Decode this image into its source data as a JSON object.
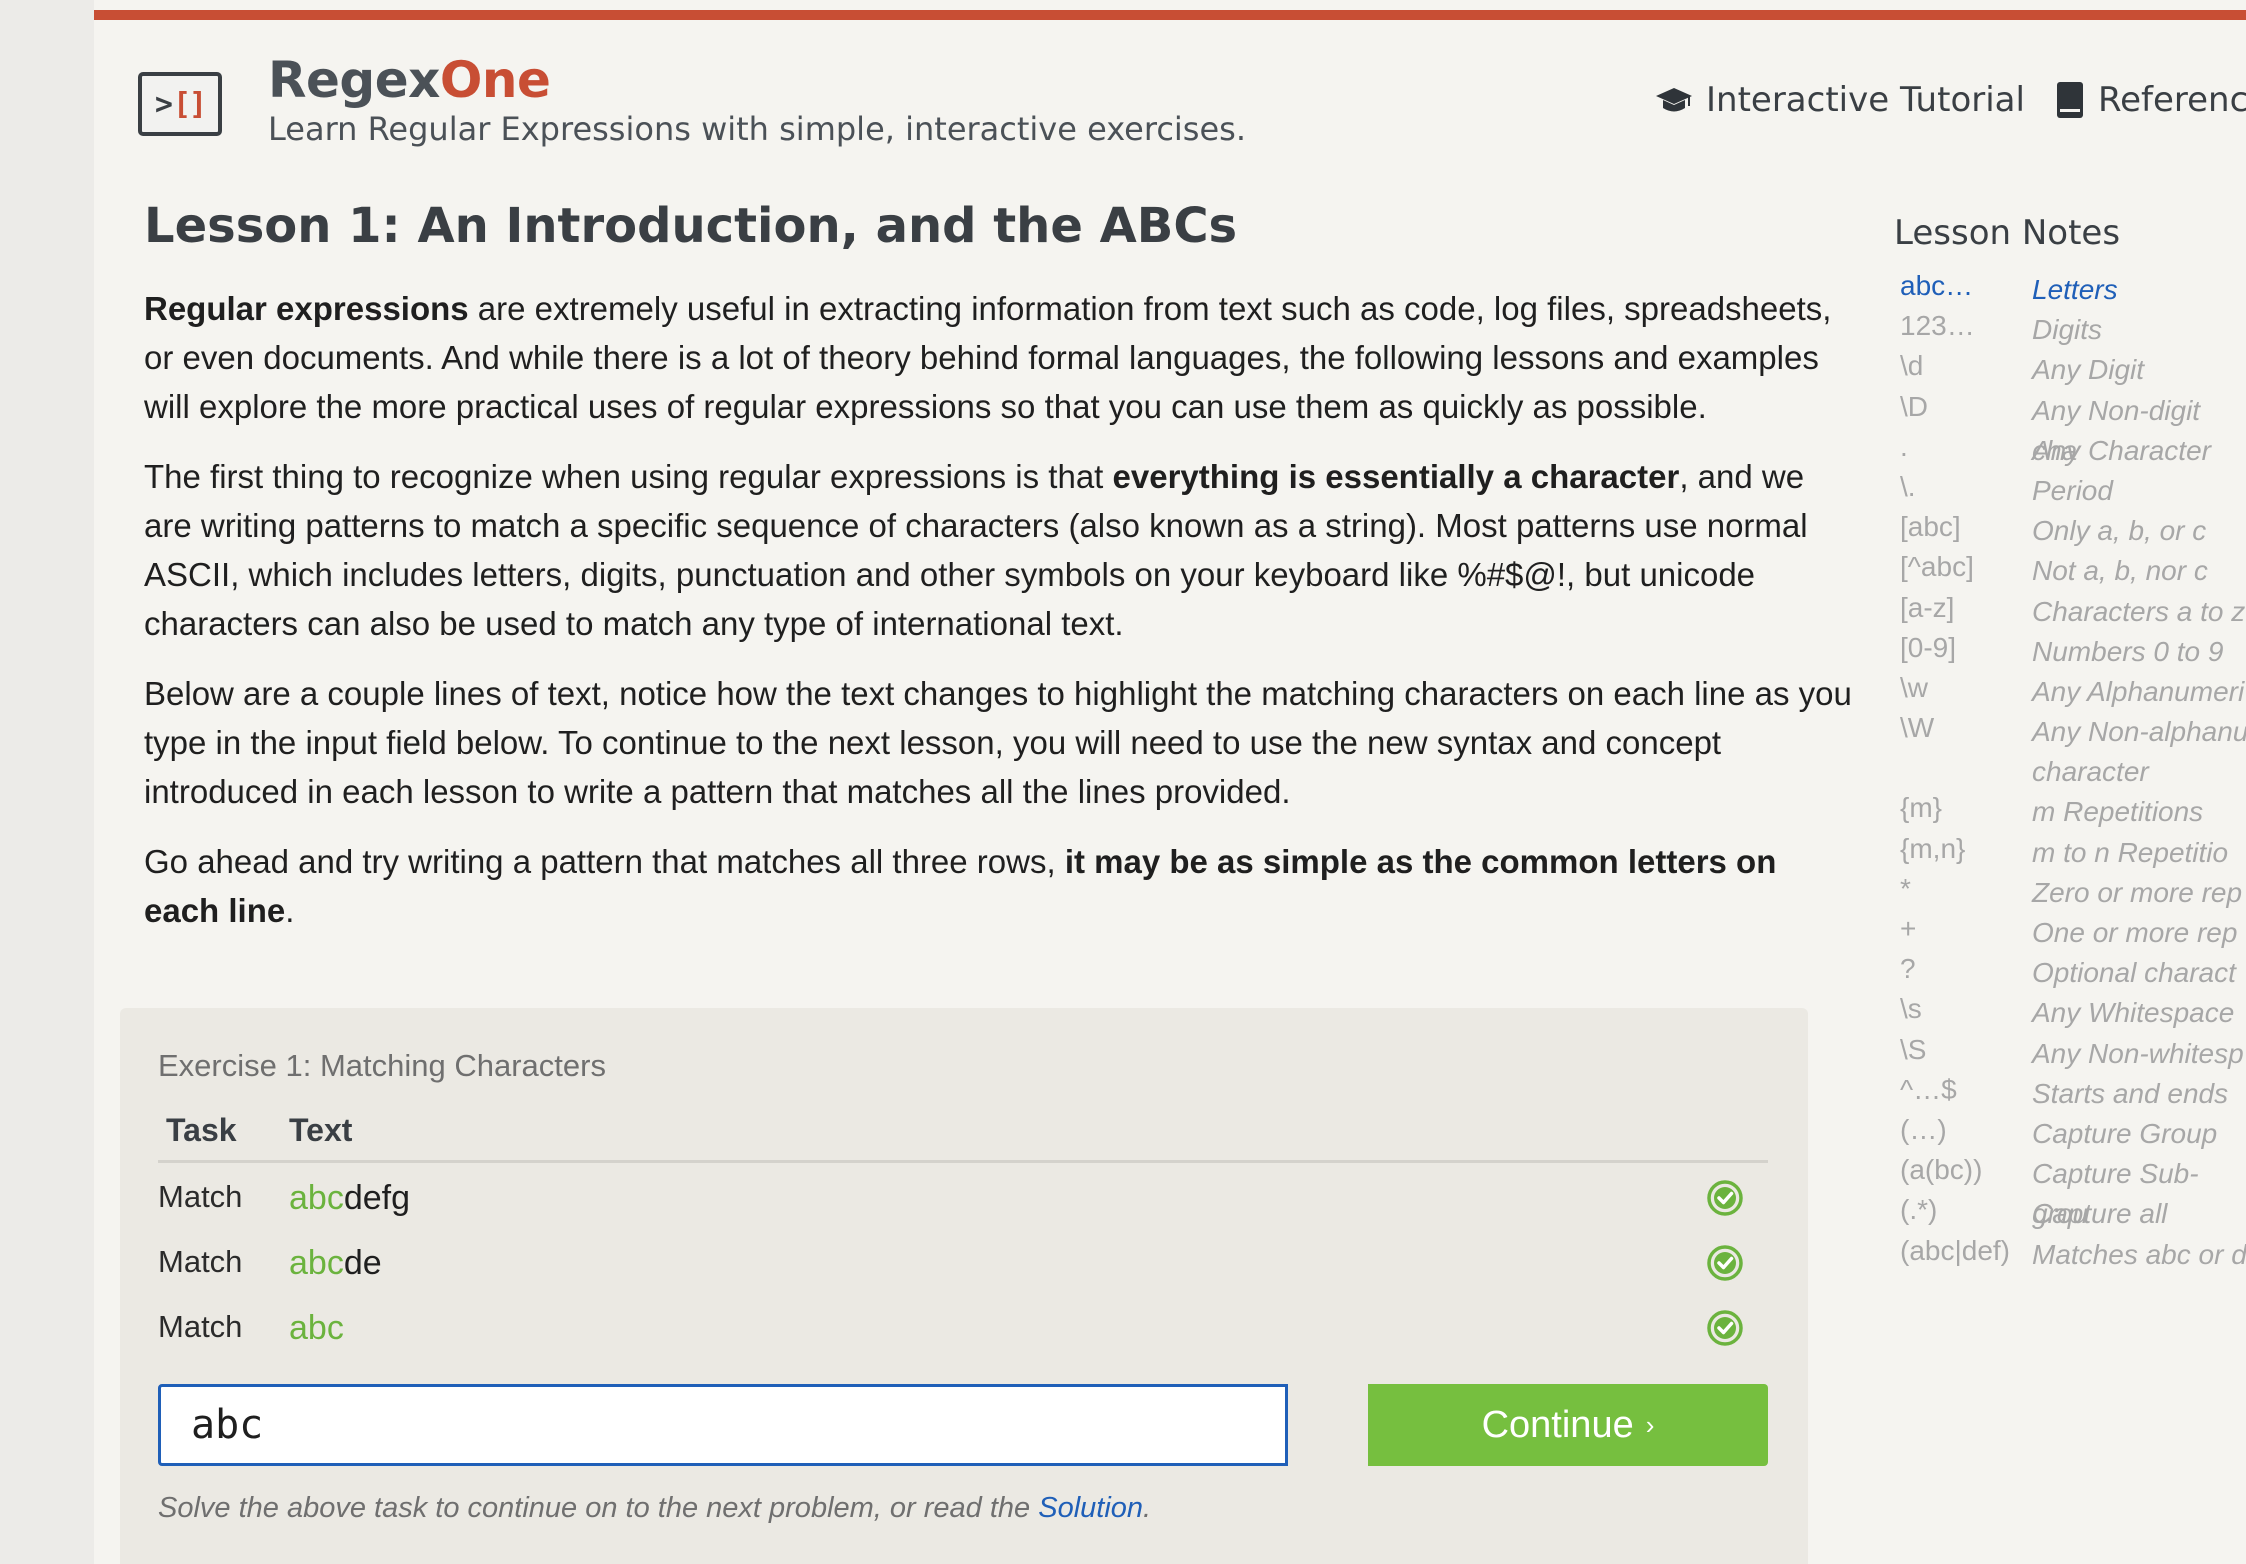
{
  "header": {
    "brand_part1": "Regex",
    "brand_part2": "One",
    "tagline": "Learn Regular Expressions with simple, interactive exercises.",
    "nav": [
      {
        "label": "Interactive Tutorial",
        "icon": "graduation-cap-icon"
      },
      {
        "label": "Referenc",
        "icon": "book-icon"
      }
    ]
  },
  "lesson": {
    "title": "Lesson 1: An Introduction, and the ABCs",
    "p1_bold": "Regular expressions",
    "p1_rest": " are extremely useful in extracting information from text such as code, log files, spreadsheets, or even documents. And while there is a lot of theory behind formal languages, the following lessons and examples will explore the more practical uses of regular expressions so that you can use them as quickly as possible.",
    "p2_start": "The first thing to recognize when using regular expressions is that ",
    "p2_bold": "everything is essentially a character",
    "p2_rest": ", and we are writing patterns to match a specific sequence of characters (also known as a string). Most patterns use normal ASCII, which includes letters, digits, punctuation and other symbols on your keyboard like %#$@!, but unicode characters can also be used to match any type of international text.",
    "p3": "Below are a couple lines of text, notice how the text changes to highlight the matching characters on each line as you type in the input field below. To continue to the next lesson, you will need to use the new syntax and concept introduced in each lesson to write a pattern that matches all the lines provided.",
    "p4_start": "Go ahead and try writing a pattern that matches all three rows, ",
    "p4_bold": "it may be as simple as the common letters on each line",
    "p4_end": "."
  },
  "exercise": {
    "title": "Exercise 1: Matching Characters",
    "col_task": "Task",
    "col_text": "Text",
    "rows": [
      {
        "task": "Match",
        "matched": "abc",
        "rest": "defg",
        "status": "success"
      },
      {
        "task": "Match",
        "matched": "abc",
        "rest": "de",
        "status": "success"
      },
      {
        "task": "Match",
        "matched": "abc",
        "rest": "",
        "status": "success"
      }
    ],
    "input_value": "abc",
    "continue_label": "Continue",
    "continue_arrow": "›",
    "footer_text": "Solve the above task to continue on to the next problem, or read the ",
    "solution_link": "Solution",
    "footer_end": ".",
    "colors": {
      "match": "#6bb33e",
      "button": "#76bf3f",
      "input_border": "#1f5fb8"
    }
  },
  "notes": {
    "title": "Lesson Notes",
    "items": [
      {
        "sym": "abc…",
        "desc": "Letters",
        "active": true
      },
      {
        "sym": "123…",
        "desc": "Digits"
      },
      {
        "sym": "\\d",
        "desc": "Any Digit"
      },
      {
        "sym": "\\D",
        "desc": "Any Non-digit cha"
      },
      {
        "sym": ".",
        "desc": "Any Character"
      },
      {
        "sym": "\\.",
        "desc": "Period"
      },
      {
        "sym": "[abc]",
        "desc": "Only a, b, or c"
      },
      {
        "sym": "[^abc]",
        "desc": "Not a, b, nor c"
      },
      {
        "sym": "[a-z]",
        "desc": "Characters a to z"
      },
      {
        "sym": "[0-9]",
        "desc": "Numbers 0 to 9"
      },
      {
        "sym": "\\w",
        "desc": "Any Alphanumeri"
      },
      {
        "sym": "\\W",
        "desc": "Any Non-alphanu character"
      },
      {
        "sym": "{m}",
        "desc": "m Repetitions"
      },
      {
        "sym": "{m,n}",
        "desc": "m to n Repetitio"
      },
      {
        "sym": "*",
        "desc": "Zero or more rep"
      },
      {
        "sym": "+",
        "desc": "One or more rep"
      },
      {
        "sym": "?",
        "desc": "Optional charact"
      },
      {
        "sym": "\\s",
        "desc": "Any Whitespace"
      },
      {
        "sym": "\\S",
        "desc": "Any Non-whitesp"
      },
      {
        "sym": "^…$",
        "desc": "Starts and ends"
      },
      {
        "sym": "(…)",
        "desc": "Capture Group"
      },
      {
        "sym": "(a(bc))",
        "desc": "Capture Sub-grou"
      },
      {
        "sym": "(.*)",
        "desc": "Capture all"
      },
      {
        "sym": "(abc|def)",
        "desc": "Matches abc or d"
      }
    ]
  }
}
